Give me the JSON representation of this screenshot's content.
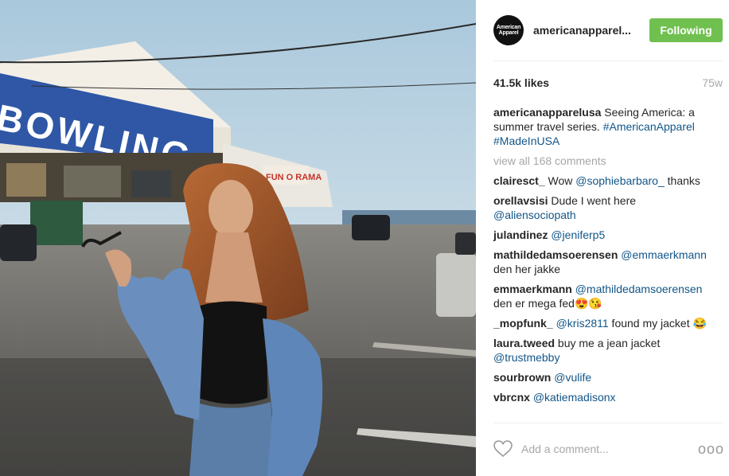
{
  "photo": {
    "sign_text": "BOWLING",
    "sign2_text": "FUN O RAMA",
    "alt": ""
  },
  "post": {
    "avatar_line1": "American",
    "avatar_line2": "Apparel",
    "username": "americanapparel...",
    "follow_label": "Following",
    "likes": "41.5k likes",
    "time": "75w",
    "caption": {
      "user": "americanapparelusa",
      "text": "Seeing America: a summer travel series. ",
      "tags": "#AmericanApparel #MadeInUSA"
    },
    "view_all": "view all 168 comments",
    "add_comment_placeholder": "Add a comment...",
    "more_label": "ooo"
  },
  "comments": [
    {
      "user": "clairesct_",
      "pre": "Wow ",
      "mention": "@sophiebarbaro_",
      "post": " thanks"
    },
    {
      "user": "orellavsisi",
      "pre": "Dude I went here ",
      "mention": "@aliensociopath",
      "post": ""
    },
    {
      "user": "julandinez",
      "pre": "",
      "mention": "@jeniferp5",
      "post": ""
    },
    {
      "user": "mathildedamsoerensen",
      "pre": "",
      "mention": "@emmaerkmann",
      "post": " den her jakke"
    },
    {
      "user": "emmaerkmann",
      "pre": "",
      "mention": "@mathildedamsoerensen",
      "post": " den er mega fed😍😘"
    },
    {
      "user": "_mopfunk_",
      "pre": "",
      "mention": "@kris2811",
      "post": " found my jacket 😂"
    },
    {
      "user": "laura.tweed",
      "pre": "buy me a jean jacket ",
      "mention": "@trustmebby",
      "post": ""
    },
    {
      "user": "sourbrown",
      "pre": "",
      "mention": "@vulife",
      "post": ""
    },
    {
      "user": "vbrcnx",
      "pre": "",
      "mention": "@katiemadisonx",
      "post": ""
    }
  ],
  "colors": {
    "follow": "#70c050",
    "link": "#125688",
    "muted": "#a5a7aa"
  }
}
